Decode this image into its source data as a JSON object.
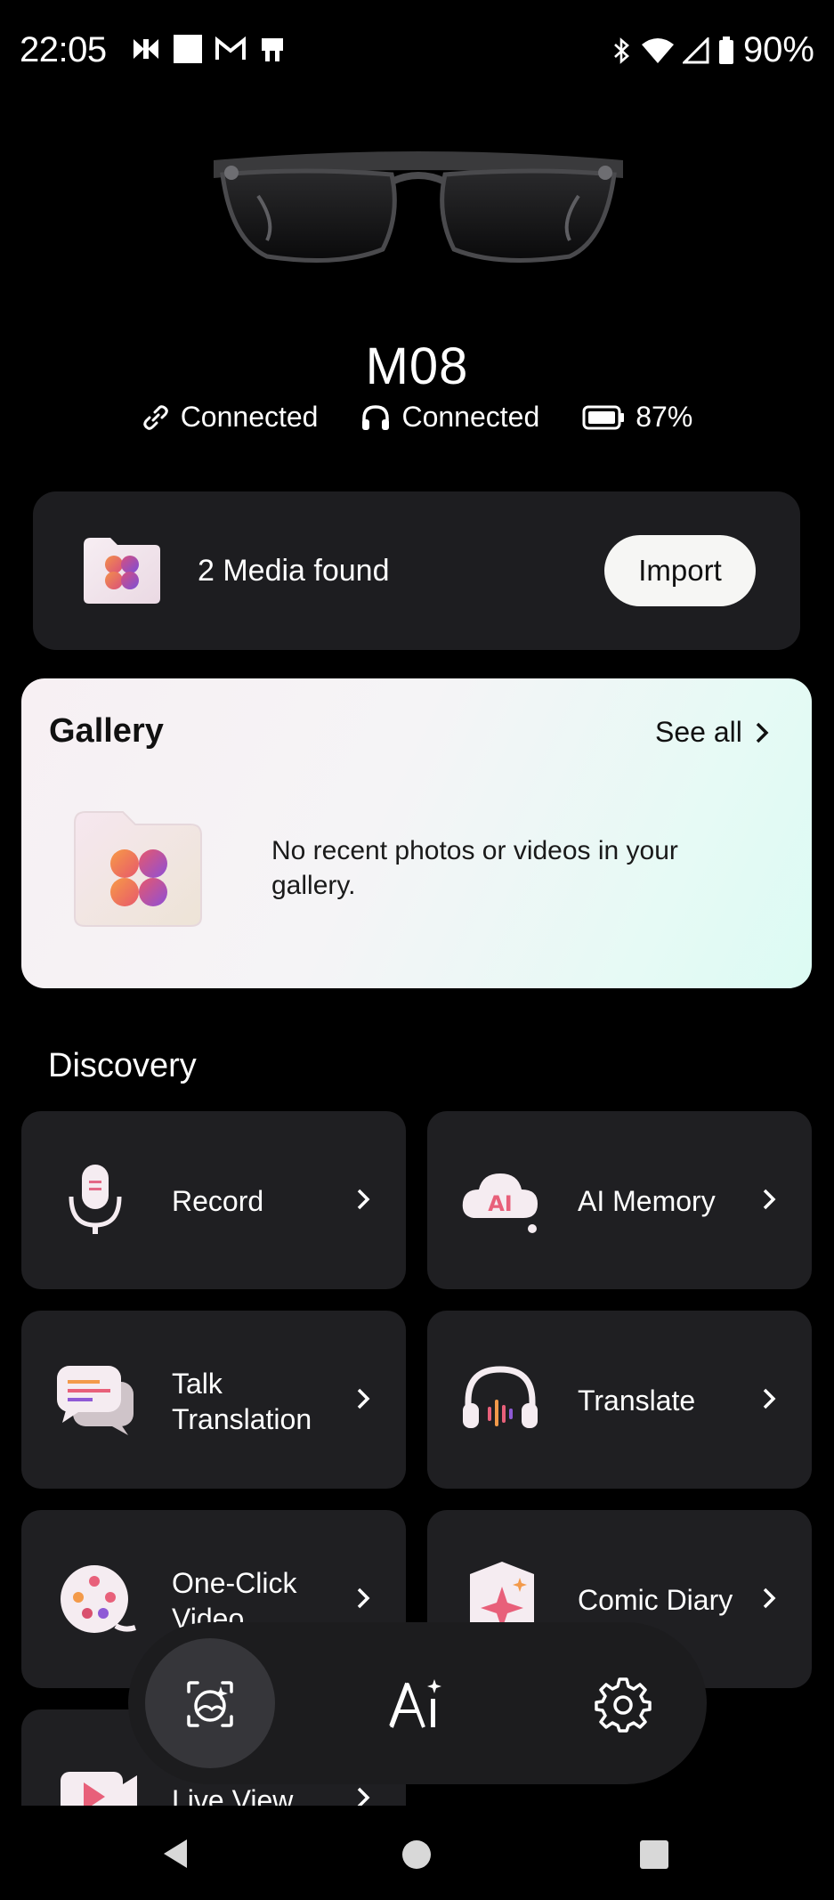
{
  "status_bar": {
    "time": "22:05",
    "battery": "90%",
    "left_icons": [
      "media-icon",
      "stop-icon",
      "gmail-icon",
      "device-icon"
    ],
    "right_icons": [
      "bluetooth-icon",
      "wifi-icon",
      "signal-icon",
      "battery-icon"
    ]
  },
  "device": {
    "name": "M08",
    "link_status": "Connected",
    "audio_status": "Connected",
    "battery": "87%"
  },
  "media": {
    "text": "2 Media found",
    "import_label": "Import"
  },
  "gallery": {
    "title": "Gallery",
    "see_all": "See all",
    "empty_text": "No recent photos or videos in your gallery."
  },
  "discovery": {
    "title": "Discovery",
    "tiles": [
      {
        "label": "Record"
      },
      {
        "label": "AI Memory",
        "badge": "AI"
      },
      {
        "label": "Talk Translation"
      },
      {
        "label": "Translate"
      },
      {
        "label": "One-Click Video"
      },
      {
        "label": "Comic Diary"
      },
      {
        "label": "Live View"
      }
    ]
  },
  "nav": {
    "items": [
      "gallery-nav-icon",
      "ai-nav-icon",
      "settings-nav-icon"
    ]
  },
  "colors": {
    "background": "#000000",
    "card": "#1f1f22",
    "accent_pink": "#e8607a",
    "accent_orange": "#f39a4a",
    "accent_purple": "#8f5ad6"
  }
}
